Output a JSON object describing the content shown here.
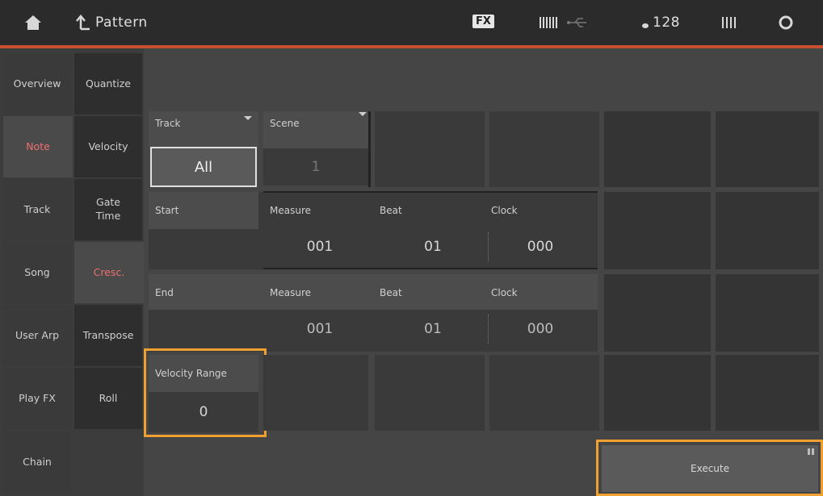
{
  "topbar": {
    "title": "Pattern",
    "fx_badge": "FX",
    "tempo": "128",
    "icons": [
      "home-icon",
      "back-arrow-icon",
      "midi-meter-icon",
      "usb-icon",
      "tempo-note-icon",
      "level-meter-icon",
      "circle-icon"
    ]
  },
  "sidebar": {
    "level1": [
      {
        "label": "Overview",
        "selected": false
      },
      {
        "label": "Note",
        "selected": true
      },
      {
        "label": "Track",
        "selected": false
      },
      {
        "label": "Song",
        "selected": false
      },
      {
        "label": "User Arp",
        "selected": false
      },
      {
        "label": "Play FX",
        "selected": false
      },
      {
        "label": "Chain",
        "selected": false
      }
    ],
    "level2": [
      {
        "label": "Quantize",
        "selected": false
      },
      {
        "label": "Velocity",
        "selected": false
      },
      {
        "label": "Gate Time",
        "selected": false
      },
      {
        "label": "Cresc.",
        "selected": true
      },
      {
        "label": "Transpose",
        "selected": false
      },
      {
        "label": "Roll",
        "selected": false
      }
    ]
  },
  "params": {
    "track": {
      "label": "Track",
      "value": "All"
    },
    "scene": {
      "label": "Scene",
      "value": "1"
    },
    "start": {
      "label": "Start",
      "measure_label": "Measure",
      "beat_label": "Beat",
      "clock_label": "Clock",
      "measure": "001",
      "beat": "01",
      "clock": "000"
    },
    "end": {
      "label": "End",
      "measure_label": "Measure",
      "beat_label": "Beat",
      "clock_label": "Clock",
      "measure": "001",
      "beat": "01",
      "clock": "000"
    },
    "velocity_range": {
      "label": "Velocity Range",
      "value": "0"
    }
  },
  "execute": {
    "label": "Execute"
  },
  "colors": {
    "accent_red": "#c85030",
    "highlight_orange": "#f0a030",
    "selected_text": "#f07070"
  }
}
